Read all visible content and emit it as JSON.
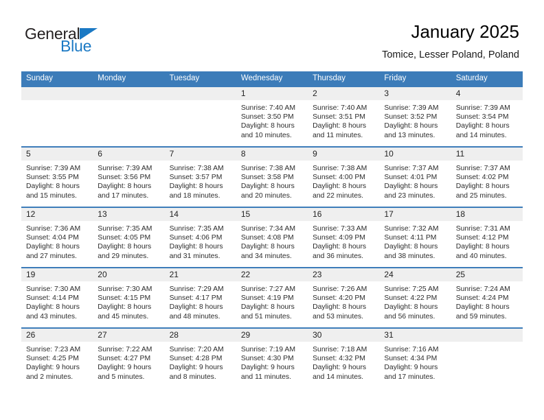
{
  "brand": {
    "name_part1": "General",
    "name_part2": "Blue",
    "triangle_icon": "brand-triangle-icon",
    "colors": {
      "dark": "#231f20",
      "blue": "#1b79c4"
    }
  },
  "header": {
    "title": "January 2025",
    "subtitle": "Tomice, Lesser Poland, Poland"
  },
  "theme": {
    "header_blue": "#3c7cb9",
    "band_gray": "#efefef",
    "text": "#2b2b2b"
  },
  "calendar": {
    "weekdays": [
      "Sunday",
      "Monday",
      "Tuesday",
      "Wednesday",
      "Thursday",
      "Friday",
      "Saturday"
    ],
    "weeks": [
      [
        {
          "day": "",
          "empty": true
        },
        {
          "day": "",
          "empty": true
        },
        {
          "day": "",
          "empty": true
        },
        {
          "day": "1",
          "sunrise": "Sunrise: 7:40 AM",
          "sunset": "Sunset: 3:50 PM",
          "daylight1": "Daylight: 8 hours",
          "daylight2": "and 10 minutes."
        },
        {
          "day": "2",
          "sunrise": "Sunrise: 7:40 AM",
          "sunset": "Sunset: 3:51 PM",
          "daylight1": "Daylight: 8 hours",
          "daylight2": "and 11 minutes."
        },
        {
          "day": "3",
          "sunrise": "Sunrise: 7:39 AM",
          "sunset": "Sunset: 3:52 PM",
          "daylight1": "Daylight: 8 hours",
          "daylight2": "and 13 minutes."
        },
        {
          "day": "4",
          "sunrise": "Sunrise: 7:39 AM",
          "sunset": "Sunset: 3:54 PM",
          "daylight1": "Daylight: 8 hours",
          "daylight2": "and 14 minutes."
        }
      ],
      [
        {
          "day": "5",
          "sunrise": "Sunrise: 7:39 AM",
          "sunset": "Sunset: 3:55 PM",
          "daylight1": "Daylight: 8 hours",
          "daylight2": "and 15 minutes."
        },
        {
          "day": "6",
          "sunrise": "Sunrise: 7:39 AM",
          "sunset": "Sunset: 3:56 PM",
          "daylight1": "Daylight: 8 hours",
          "daylight2": "and 17 minutes."
        },
        {
          "day": "7",
          "sunrise": "Sunrise: 7:38 AM",
          "sunset": "Sunset: 3:57 PM",
          "daylight1": "Daylight: 8 hours",
          "daylight2": "and 18 minutes."
        },
        {
          "day": "8",
          "sunrise": "Sunrise: 7:38 AM",
          "sunset": "Sunset: 3:58 PM",
          "daylight1": "Daylight: 8 hours",
          "daylight2": "and 20 minutes."
        },
        {
          "day": "9",
          "sunrise": "Sunrise: 7:38 AM",
          "sunset": "Sunset: 4:00 PM",
          "daylight1": "Daylight: 8 hours",
          "daylight2": "and 22 minutes."
        },
        {
          "day": "10",
          "sunrise": "Sunrise: 7:37 AM",
          "sunset": "Sunset: 4:01 PM",
          "daylight1": "Daylight: 8 hours",
          "daylight2": "and 23 minutes."
        },
        {
          "day": "11",
          "sunrise": "Sunrise: 7:37 AM",
          "sunset": "Sunset: 4:02 PM",
          "daylight1": "Daylight: 8 hours",
          "daylight2": "and 25 minutes."
        }
      ],
      [
        {
          "day": "12",
          "sunrise": "Sunrise: 7:36 AM",
          "sunset": "Sunset: 4:04 PM",
          "daylight1": "Daylight: 8 hours",
          "daylight2": "and 27 minutes."
        },
        {
          "day": "13",
          "sunrise": "Sunrise: 7:35 AM",
          "sunset": "Sunset: 4:05 PM",
          "daylight1": "Daylight: 8 hours",
          "daylight2": "and 29 minutes."
        },
        {
          "day": "14",
          "sunrise": "Sunrise: 7:35 AM",
          "sunset": "Sunset: 4:06 PM",
          "daylight1": "Daylight: 8 hours",
          "daylight2": "and 31 minutes."
        },
        {
          "day": "15",
          "sunrise": "Sunrise: 7:34 AM",
          "sunset": "Sunset: 4:08 PM",
          "daylight1": "Daylight: 8 hours",
          "daylight2": "and 34 minutes."
        },
        {
          "day": "16",
          "sunrise": "Sunrise: 7:33 AM",
          "sunset": "Sunset: 4:09 PM",
          "daylight1": "Daylight: 8 hours",
          "daylight2": "and 36 minutes."
        },
        {
          "day": "17",
          "sunrise": "Sunrise: 7:32 AM",
          "sunset": "Sunset: 4:11 PM",
          "daylight1": "Daylight: 8 hours",
          "daylight2": "and 38 minutes."
        },
        {
          "day": "18",
          "sunrise": "Sunrise: 7:31 AM",
          "sunset": "Sunset: 4:12 PM",
          "daylight1": "Daylight: 8 hours",
          "daylight2": "and 40 minutes."
        }
      ],
      [
        {
          "day": "19",
          "sunrise": "Sunrise: 7:30 AM",
          "sunset": "Sunset: 4:14 PM",
          "daylight1": "Daylight: 8 hours",
          "daylight2": "and 43 minutes."
        },
        {
          "day": "20",
          "sunrise": "Sunrise: 7:30 AM",
          "sunset": "Sunset: 4:15 PM",
          "daylight1": "Daylight: 8 hours",
          "daylight2": "and 45 minutes."
        },
        {
          "day": "21",
          "sunrise": "Sunrise: 7:29 AM",
          "sunset": "Sunset: 4:17 PM",
          "daylight1": "Daylight: 8 hours",
          "daylight2": "and 48 minutes."
        },
        {
          "day": "22",
          "sunrise": "Sunrise: 7:27 AM",
          "sunset": "Sunset: 4:19 PM",
          "daylight1": "Daylight: 8 hours",
          "daylight2": "and 51 minutes."
        },
        {
          "day": "23",
          "sunrise": "Sunrise: 7:26 AM",
          "sunset": "Sunset: 4:20 PM",
          "daylight1": "Daylight: 8 hours",
          "daylight2": "and 53 minutes."
        },
        {
          "day": "24",
          "sunrise": "Sunrise: 7:25 AM",
          "sunset": "Sunset: 4:22 PM",
          "daylight1": "Daylight: 8 hours",
          "daylight2": "and 56 minutes."
        },
        {
          "day": "25",
          "sunrise": "Sunrise: 7:24 AM",
          "sunset": "Sunset: 4:24 PM",
          "daylight1": "Daylight: 8 hours",
          "daylight2": "and 59 minutes."
        }
      ],
      [
        {
          "day": "26",
          "sunrise": "Sunrise: 7:23 AM",
          "sunset": "Sunset: 4:25 PM",
          "daylight1": "Daylight: 9 hours",
          "daylight2": "and 2 minutes."
        },
        {
          "day": "27",
          "sunrise": "Sunrise: 7:22 AM",
          "sunset": "Sunset: 4:27 PM",
          "daylight1": "Daylight: 9 hours",
          "daylight2": "and 5 minutes."
        },
        {
          "day": "28",
          "sunrise": "Sunrise: 7:20 AM",
          "sunset": "Sunset: 4:28 PM",
          "daylight1": "Daylight: 9 hours",
          "daylight2": "and 8 minutes."
        },
        {
          "day": "29",
          "sunrise": "Sunrise: 7:19 AM",
          "sunset": "Sunset: 4:30 PM",
          "daylight1": "Daylight: 9 hours",
          "daylight2": "and 11 minutes."
        },
        {
          "day": "30",
          "sunrise": "Sunrise: 7:18 AM",
          "sunset": "Sunset: 4:32 PM",
          "daylight1": "Daylight: 9 hours",
          "daylight2": "and 14 minutes."
        },
        {
          "day": "31",
          "sunrise": "Sunrise: 7:16 AM",
          "sunset": "Sunset: 4:34 PM",
          "daylight1": "Daylight: 9 hours",
          "daylight2": "and 17 minutes."
        },
        {
          "day": "",
          "empty": true
        }
      ]
    ]
  }
}
